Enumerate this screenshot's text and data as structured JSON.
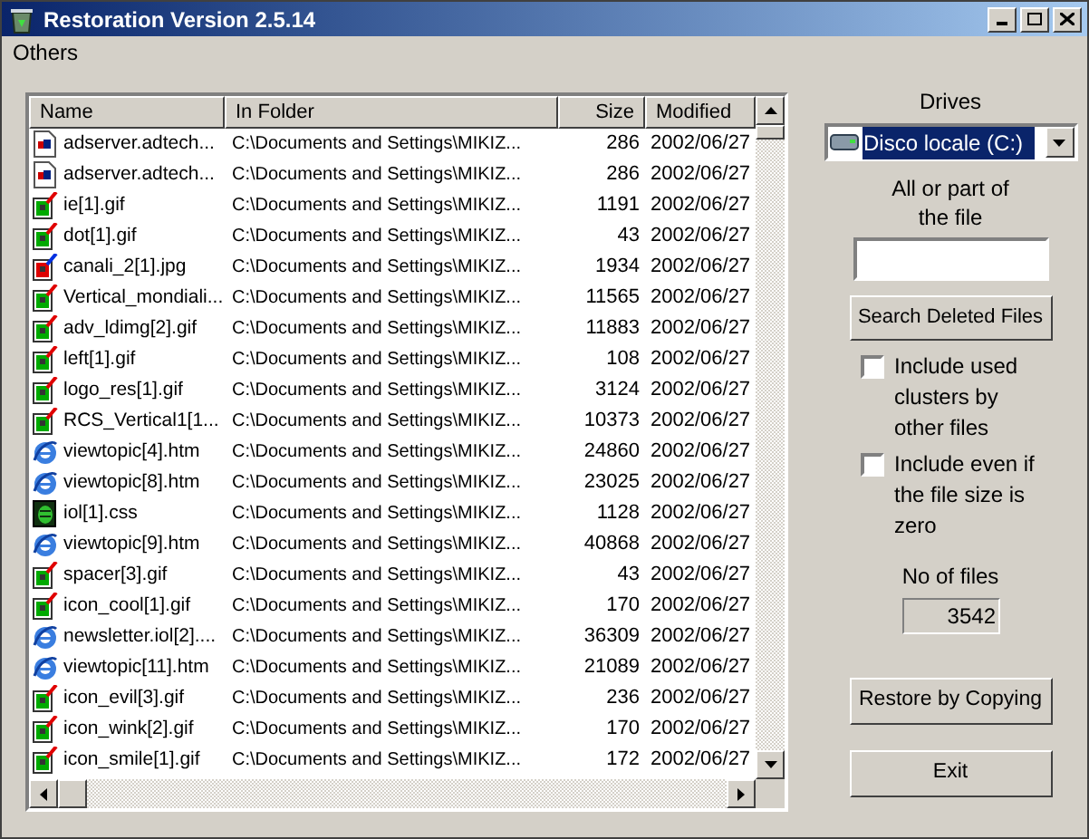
{
  "window": {
    "title": "Restoration Version 2.5.14"
  },
  "menu": [
    "Others"
  ],
  "table": {
    "columns": [
      "Name",
      "In Folder",
      "Size",
      "Modified"
    ],
    "rows": [
      {
        "kind": "script",
        "name": "adserver.adtech...",
        "folder": "C:\\Documents and Settings\\MIKIZ...",
        "size": "286",
        "modified": "2002/06/27"
      },
      {
        "kind": "script",
        "name": "adserver.adtech...",
        "folder": "C:\\Documents and Settings\\MIKIZ...",
        "size": "286",
        "modified": "2002/06/27"
      },
      {
        "kind": "image",
        "name": "ie[1].gif",
        "folder": "C:\\Documents and Settings\\MIKIZ...",
        "size": "1191",
        "modified": "2002/06/27"
      },
      {
        "kind": "image",
        "name": "dot[1].gif",
        "folder": "C:\\Documents and Settings\\MIKIZ...",
        "size": "43",
        "modified": "2002/06/27"
      },
      {
        "kind": "photo",
        "name": "canali_2[1].jpg",
        "folder": "C:\\Documents and Settings\\MIKIZ...",
        "size": "1934",
        "modified": "2002/06/27"
      },
      {
        "kind": "image",
        "name": "Vertical_mondiali...",
        "folder": "C:\\Documents and Settings\\MIKIZ...",
        "size": "11565",
        "modified": "2002/06/27"
      },
      {
        "kind": "image",
        "name": "adv_ldimg[2].gif",
        "folder": "C:\\Documents and Settings\\MIKIZ...",
        "size": "11883",
        "modified": "2002/06/27"
      },
      {
        "kind": "image",
        "name": "left[1].gif",
        "folder": "C:\\Documents and Settings\\MIKIZ...",
        "size": "108",
        "modified": "2002/06/27"
      },
      {
        "kind": "image",
        "name": "logo_res[1].gif",
        "folder": "C:\\Documents and Settings\\MIKIZ...",
        "size": "3124",
        "modified": "2002/06/27"
      },
      {
        "kind": "image",
        "name": "RCS_Vertical1[1...",
        "folder": "C:\\Documents and Settings\\MIKIZ...",
        "size": "10373",
        "modified": "2002/06/27"
      },
      {
        "kind": "web",
        "name": "viewtopic[4].htm",
        "folder": "C:\\Documents and Settings\\MIKIZ...",
        "size": "24860",
        "modified": "2002/06/27"
      },
      {
        "kind": "web",
        "name": "viewtopic[8].htm",
        "folder": "C:\\Documents and Settings\\MIKIZ...",
        "size": "23025",
        "modified": "2002/06/27"
      },
      {
        "kind": "style",
        "name": "iol[1].css",
        "folder": "C:\\Documents and Settings\\MIKIZ...",
        "size": "1128",
        "modified": "2002/06/27"
      },
      {
        "kind": "web",
        "name": "viewtopic[9].htm",
        "folder": "C:\\Documents and Settings\\MIKIZ...",
        "size": "40868",
        "modified": "2002/06/27"
      },
      {
        "kind": "image",
        "name": "spacer[3].gif",
        "folder": "C:\\Documents and Settings\\MIKIZ...",
        "size": "43",
        "modified": "2002/06/27"
      },
      {
        "kind": "image",
        "name": "icon_cool[1].gif",
        "folder": "C:\\Documents and Settings\\MIKIZ...",
        "size": "170",
        "modified": "2002/06/27"
      },
      {
        "kind": "web",
        "name": "newsletter.iol[2]....",
        "folder": "C:\\Documents and Settings\\MIKIZ...",
        "size": "36309",
        "modified": "2002/06/27"
      },
      {
        "kind": "web",
        "name": "viewtopic[11].htm",
        "folder": "C:\\Documents and Settings\\MIKIZ...",
        "size": "21089",
        "modified": "2002/06/27"
      },
      {
        "kind": "image",
        "name": "icon_evil[3].gif",
        "folder": "C:\\Documents and Settings\\MIKIZ...",
        "size": "236",
        "modified": "2002/06/27"
      },
      {
        "kind": "image",
        "name": "icon_wink[2].gif",
        "folder": "C:\\Documents and Settings\\MIKIZ...",
        "size": "170",
        "modified": "2002/06/27"
      },
      {
        "kind": "image",
        "name": "icon_smile[1].gif",
        "folder": "C:\\Documents and Settings\\MIKIZ...",
        "size": "172",
        "modified": "2002/06/27"
      }
    ]
  },
  "drives": {
    "label": "Drives",
    "value": "Disco locale (C:)"
  },
  "search": {
    "label": "All or part of the file"
  },
  "search_button": "Search Deleted Files",
  "options": [
    {
      "label": "Include used clusters by other files",
      "checked": false
    },
    {
      "label": "Include even if the file size is zero",
      "checked": false
    }
  ],
  "file_count": {
    "label": "No of files",
    "value": "3542"
  },
  "buttons": [
    "Restore by Copying",
    "Exit"
  ]
}
